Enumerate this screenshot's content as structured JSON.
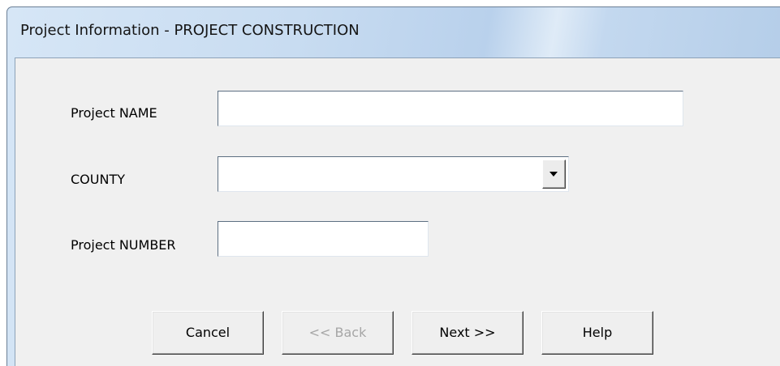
{
  "window": {
    "title": "Project Information - PROJECT CONSTRUCTION"
  },
  "form": {
    "project_name": {
      "label": "Project NAME",
      "value": ""
    },
    "county": {
      "label": "COUNTY",
      "value": ""
    },
    "project_number": {
      "label": "Project NUMBER",
      "value": ""
    }
  },
  "buttons": {
    "cancel": "Cancel",
    "back": "<< Back",
    "next": "Next >>",
    "help": "Help"
  },
  "icons": {
    "dropdown": "chevron-down-icon"
  },
  "colors": {
    "titlebar": "#c8dcf1",
    "dialog_face": "#f0f0f0",
    "disabled_text": "#a6a6a6"
  }
}
